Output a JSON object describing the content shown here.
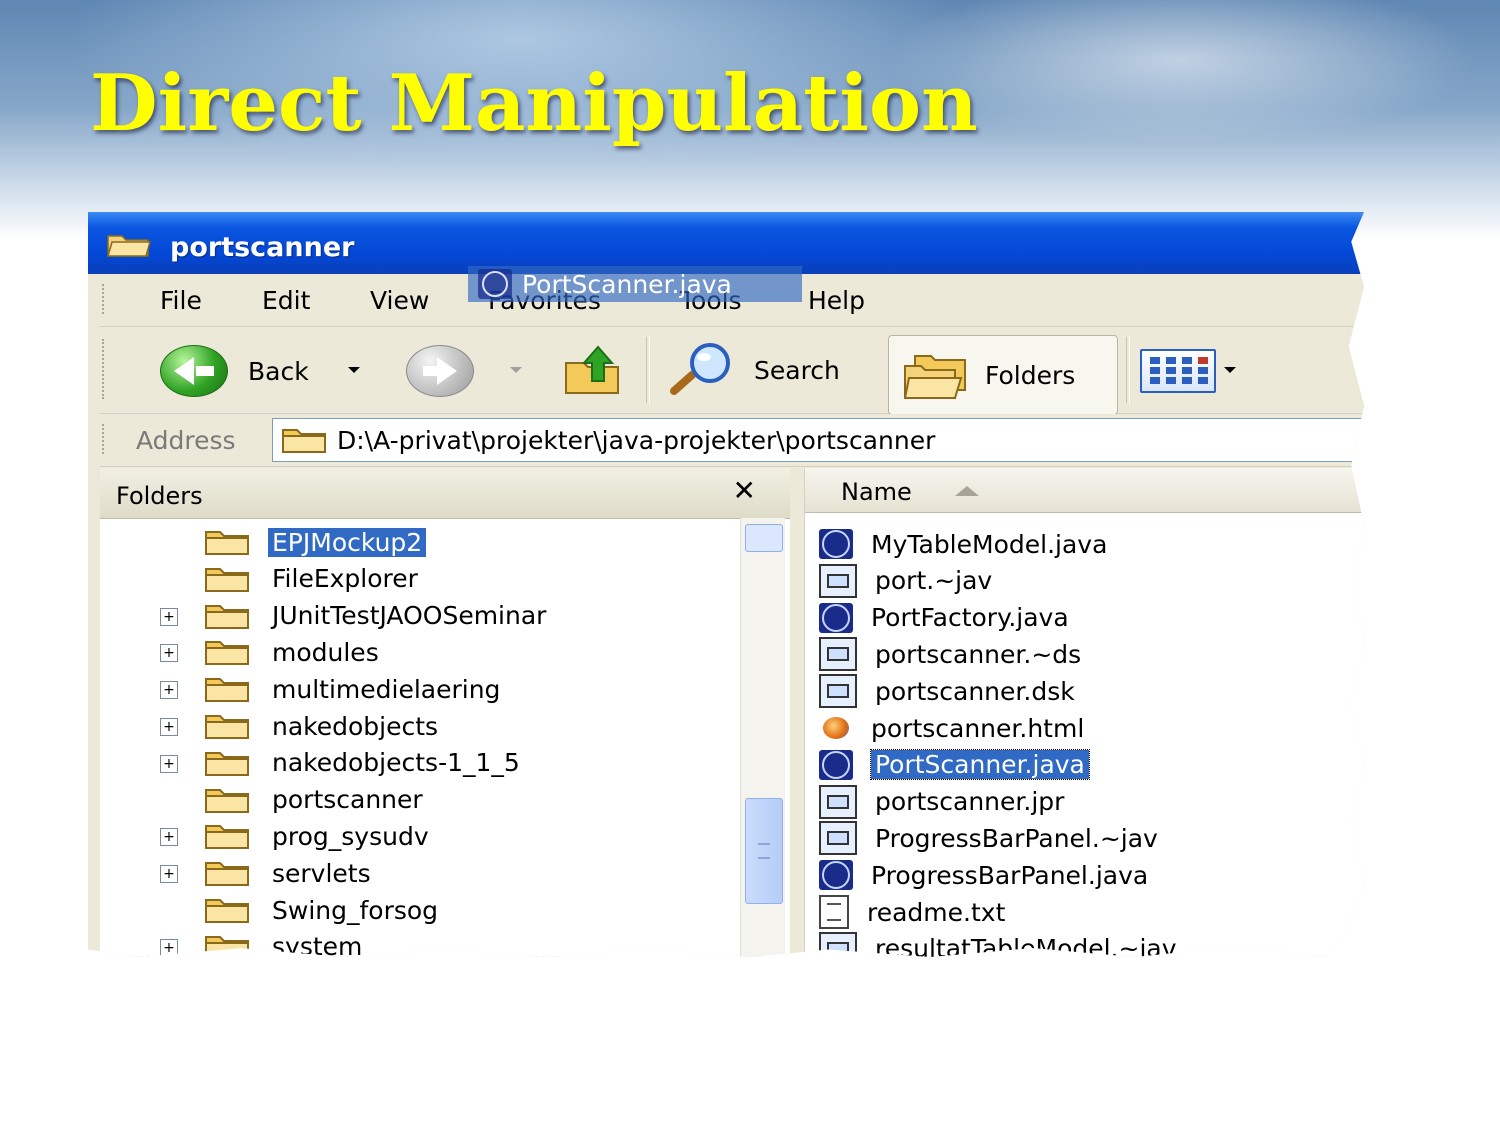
{
  "slide": {
    "title": "Direct Manipulation"
  },
  "window": {
    "title": "portscanner",
    "menu": [
      "File",
      "Edit",
      "View",
      "Favorites",
      "Tools",
      "Help"
    ],
    "toolbar": {
      "back_label": "Back",
      "search_label": "Search",
      "folders_label": "Folders"
    },
    "address": {
      "label": "Address",
      "value": "D:\\A-privat\\projekter\\java-projekter\\portscanner"
    }
  },
  "folders_panel": {
    "header": "Folders",
    "close_glyph": "✕",
    "items": [
      {
        "label": "EPJMockup2",
        "expander": false,
        "selected": true
      },
      {
        "label": "FileExplorer",
        "expander": false,
        "selected": false
      },
      {
        "label": "JUnitTestJAOOSeminar",
        "expander": true,
        "selected": false
      },
      {
        "label": "modules",
        "expander": true,
        "selected": false
      },
      {
        "label": "multimedielaering",
        "expander": true,
        "selected": false
      },
      {
        "label": "nakedobjects",
        "expander": true,
        "selected": false
      },
      {
        "label": "nakedobjects-1_1_5",
        "expander": true,
        "selected": false
      },
      {
        "label": "portscanner",
        "expander": false,
        "selected": false
      },
      {
        "label": "prog_sysudv",
        "expander": true,
        "selected": false
      },
      {
        "label": "servlets",
        "expander": true,
        "selected": false
      },
      {
        "label": "Swing_forsog",
        "expander": false,
        "selected": false
      },
      {
        "label": "system",
        "expander": true,
        "selected": false
      }
    ]
  },
  "drag_ghost": {
    "label": "PortScanner.java"
  },
  "file_list": {
    "column_header": "Name",
    "files": [
      {
        "name": "MyTableModel.java",
        "type": "java",
        "selected": false
      },
      {
        "name": "port.~jav",
        "type": "doc",
        "selected": false
      },
      {
        "name": "PortFactory.java",
        "type": "java",
        "selected": false
      },
      {
        "name": "portscanner.~ds",
        "type": "doc",
        "selected": false
      },
      {
        "name": "portscanner.dsk",
        "type": "doc",
        "selected": false
      },
      {
        "name": "portscanner.html",
        "type": "html",
        "selected": false
      },
      {
        "name": "PortScanner.java",
        "type": "java",
        "selected": true
      },
      {
        "name": "portscanner.jpr",
        "type": "doc",
        "selected": false
      },
      {
        "name": "ProgressBarPanel.~jav",
        "type": "doc",
        "selected": false
      },
      {
        "name": "ProgressBarPanel.java",
        "type": "java",
        "selected": false
      },
      {
        "name": "readme.txt",
        "type": "txt",
        "selected": false
      },
      {
        "name": "resultatTableModel.~jav",
        "type": "doc",
        "selected": false
      }
    ]
  },
  "colors": {
    "title_yellow": "#ffff00",
    "xp_blue": "#0447d6",
    "selection": "#316ac5"
  }
}
